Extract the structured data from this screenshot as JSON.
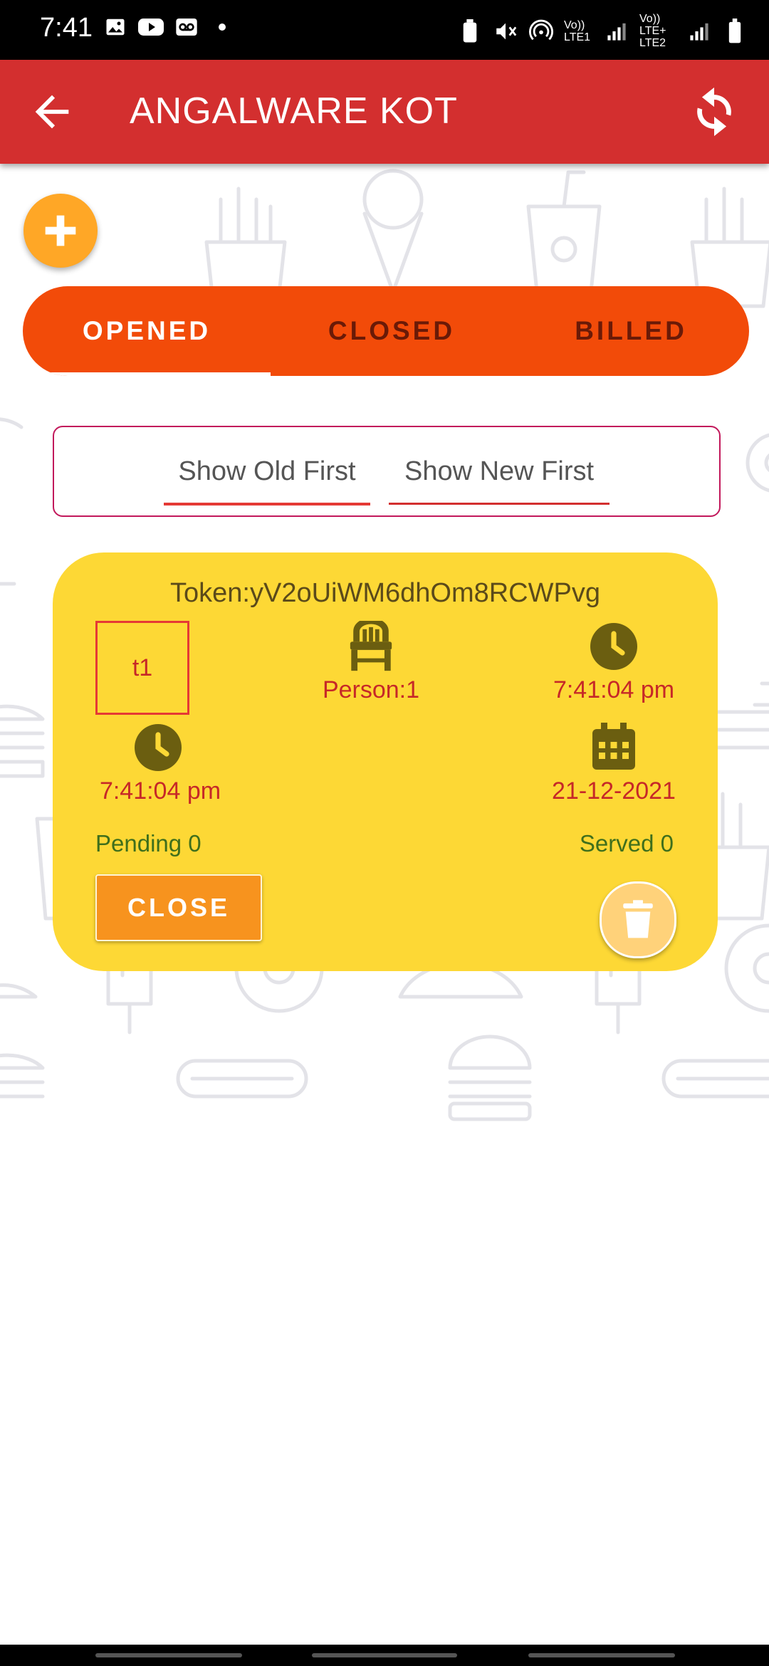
{
  "status_bar": {
    "time": "7:41",
    "sim1": "Vo)) LTE1",
    "sim2": "Vo)) LTE+ LTE2"
  },
  "app_bar": {
    "title": "ANGALWARE KOT",
    "back_icon": "arrow-left-icon",
    "refresh_icon": "refresh-icon"
  },
  "tabs": [
    {
      "label": "OPENED",
      "selected": true
    },
    {
      "label": "CLOSED",
      "selected": false
    },
    {
      "label": "BILLED",
      "selected": false
    }
  ],
  "sort": {
    "old_first": "Show Old First",
    "new_first": "Show New First"
  },
  "order_card": {
    "token": "Token:yV2oUiWM6dhOm8RCWPvg",
    "table": "t1",
    "person": "Person:1",
    "time_right": "7:41:04 pm",
    "time_left": "7:41:04 pm",
    "date": "21-12-2021",
    "pending": "Pending 0",
    "served": "Served 0",
    "close_label": "CLOSE"
  },
  "colors": {
    "app_bar": "#d32f2f",
    "tabs_bg": "#f24b09",
    "card_bg": "#fdd835",
    "fab": "#ffa726",
    "close_button": "#f7931e"
  }
}
